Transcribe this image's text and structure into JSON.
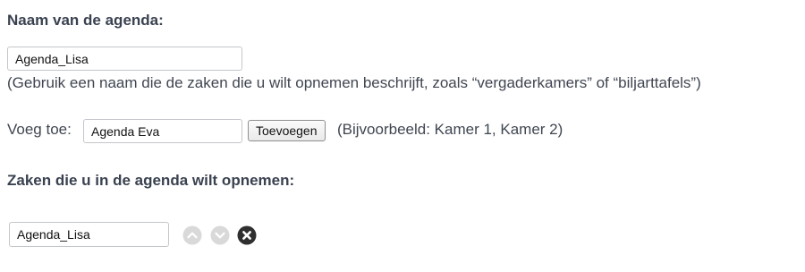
{
  "calendar_name": {
    "heading": "Naam van de agenda:",
    "value": "Agenda_Lisa",
    "hint": "(Gebruik een naam die de zaken die u wilt opnemen beschrijft, zoals “vergaderkamers” of “biljarttafels”)"
  },
  "add_item": {
    "label": "Voeg toe:",
    "value": "Agenda Eva",
    "button_label": "Toevoegen",
    "example": "(Bijvoorbeeld: Kamer 1, Kamer 2)"
  },
  "items_section": {
    "heading": "Zaken die u in de agenda wilt opnemen:",
    "items": [
      {
        "value": "Agenda_Lisa",
        "move_up_icon": "chevron-up-icon",
        "move_down_icon": "chevron-down-icon",
        "remove_icon": "close-icon"
      }
    ]
  },
  "colors": {
    "heading_text": "#3a4250",
    "body_text": "#404651",
    "disabled_icon": "#d9d9d9",
    "remove_icon": "#2f2f2f"
  }
}
